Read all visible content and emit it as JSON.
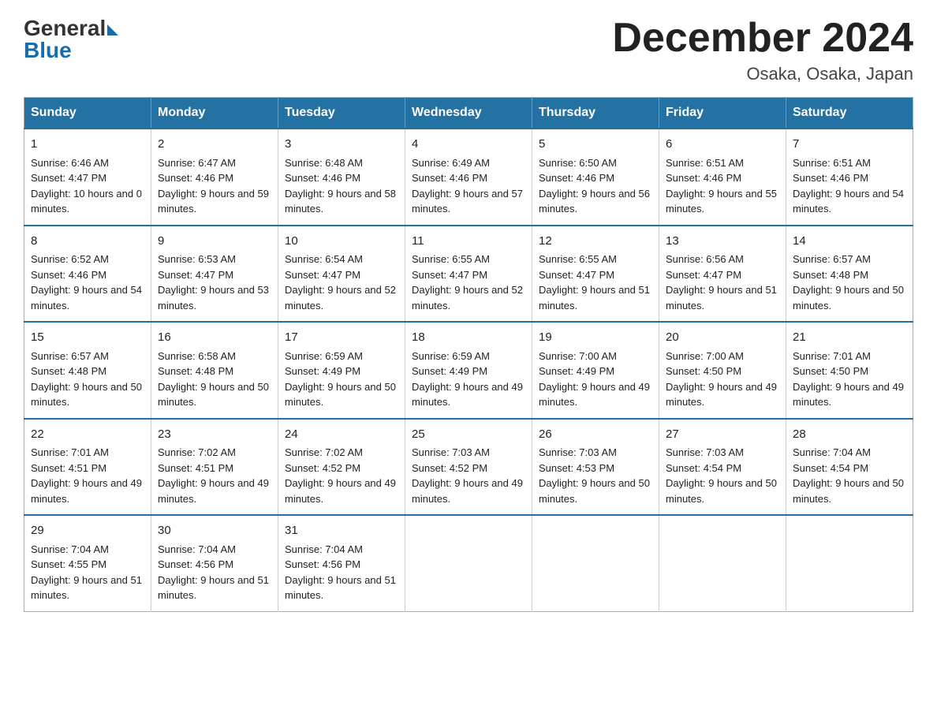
{
  "logo": {
    "general": "General",
    "blue": "Blue"
  },
  "title": {
    "month_year": "December 2024",
    "location": "Osaka, Osaka, Japan"
  },
  "weekdays": [
    "Sunday",
    "Monday",
    "Tuesday",
    "Wednesday",
    "Thursday",
    "Friday",
    "Saturday"
  ],
  "weeks": [
    [
      {
        "day": "1",
        "sunrise": "6:46 AM",
        "sunset": "4:47 PM",
        "daylight": "10 hours and 0 minutes."
      },
      {
        "day": "2",
        "sunrise": "6:47 AM",
        "sunset": "4:46 PM",
        "daylight": "9 hours and 59 minutes."
      },
      {
        "day": "3",
        "sunrise": "6:48 AM",
        "sunset": "4:46 PM",
        "daylight": "9 hours and 58 minutes."
      },
      {
        "day": "4",
        "sunrise": "6:49 AM",
        "sunset": "4:46 PM",
        "daylight": "9 hours and 57 minutes."
      },
      {
        "day": "5",
        "sunrise": "6:50 AM",
        "sunset": "4:46 PM",
        "daylight": "9 hours and 56 minutes."
      },
      {
        "day": "6",
        "sunrise": "6:51 AM",
        "sunset": "4:46 PM",
        "daylight": "9 hours and 55 minutes."
      },
      {
        "day": "7",
        "sunrise": "6:51 AM",
        "sunset": "4:46 PM",
        "daylight": "9 hours and 54 minutes."
      }
    ],
    [
      {
        "day": "8",
        "sunrise": "6:52 AM",
        "sunset": "4:46 PM",
        "daylight": "9 hours and 54 minutes."
      },
      {
        "day": "9",
        "sunrise": "6:53 AM",
        "sunset": "4:47 PM",
        "daylight": "9 hours and 53 minutes."
      },
      {
        "day": "10",
        "sunrise": "6:54 AM",
        "sunset": "4:47 PM",
        "daylight": "9 hours and 52 minutes."
      },
      {
        "day": "11",
        "sunrise": "6:55 AM",
        "sunset": "4:47 PM",
        "daylight": "9 hours and 52 minutes."
      },
      {
        "day": "12",
        "sunrise": "6:55 AM",
        "sunset": "4:47 PM",
        "daylight": "9 hours and 51 minutes."
      },
      {
        "day": "13",
        "sunrise": "6:56 AM",
        "sunset": "4:47 PM",
        "daylight": "9 hours and 51 minutes."
      },
      {
        "day": "14",
        "sunrise": "6:57 AM",
        "sunset": "4:48 PM",
        "daylight": "9 hours and 50 minutes."
      }
    ],
    [
      {
        "day": "15",
        "sunrise": "6:57 AM",
        "sunset": "4:48 PM",
        "daylight": "9 hours and 50 minutes."
      },
      {
        "day": "16",
        "sunrise": "6:58 AM",
        "sunset": "4:48 PM",
        "daylight": "9 hours and 50 minutes."
      },
      {
        "day": "17",
        "sunrise": "6:59 AM",
        "sunset": "4:49 PM",
        "daylight": "9 hours and 50 minutes."
      },
      {
        "day": "18",
        "sunrise": "6:59 AM",
        "sunset": "4:49 PM",
        "daylight": "9 hours and 49 minutes."
      },
      {
        "day": "19",
        "sunrise": "7:00 AM",
        "sunset": "4:49 PM",
        "daylight": "9 hours and 49 minutes."
      },
      {
        "day": "20",
        "sunrise": "7:00 AM",
        "sunset": "4:50 PM",
        "daylight": "9 hours and 49 minutes."
      },
      {
        "day": "21",
        "sunrise": "7:01 AM",
        "sunset": "4:50 PM",
        "daylight": "9 hours and 49 minutes."
      }
    ],
    [
      {
        "day": "22",
        "sunrise": "7:01 AM",
        "sunset": "4:51 PM",
        "daylight": "9 hours and 49 minutes."
      },
      {
        "day": "23",
        "sunrise": "7:02 AM",
        "sunset": "4:51 PM",
        "daylight": "9 hours and 49 minutes."
      },
      {
        "day": "24",
        "sunrise": "7:02 AM",
        "sunset": "4:52 PM",
        "daylight": "9 hours and 49 minutes."
      },
      {
        "day": "25",
        "sunrise": "7:03 AM",
        "sunset": "4:52 PM",
        "daylight": "9 hours and 49 minutes."
      },
      {
        "day": "26",
        "sunrise": "7:03 AM",
        "sunset": "4:53 PM",
        "daylight": "9 hours and 50 minutes."
      },
      {
        "day": "27",
        "sunrise": "7:03 AM",
        "sunset": "4:54 PM",
        "daylight": "9 hours and 50 minutes."
      },
      {
        "day": "28",
        "sunrise": "7:04 AM",
        "sunset": "4:54 PM",
        "daylight": "9 hours and 50 minutes."
      }
    ],
    [
      {
        "day": "29",
        "sunrise": "7:04 AM",
        "sunset": "4:55 PM",
        "daylight": "9 hours and 51 minutes."
      },
      {
        "day": "30",
        "sunrise": "7:04 AM",
        "sunset": "4:56 PM",
        "daylight": "9 hours and 51 minutes."
      },
      {
        "day": "31",
        "sunrise": "7:04 AM",
        "sunset": "4:56 PM",
        "daylight": "9 hours and 51 minutes."
      },
      null,
      null,
      null,
      null
    ]
  ]
}
